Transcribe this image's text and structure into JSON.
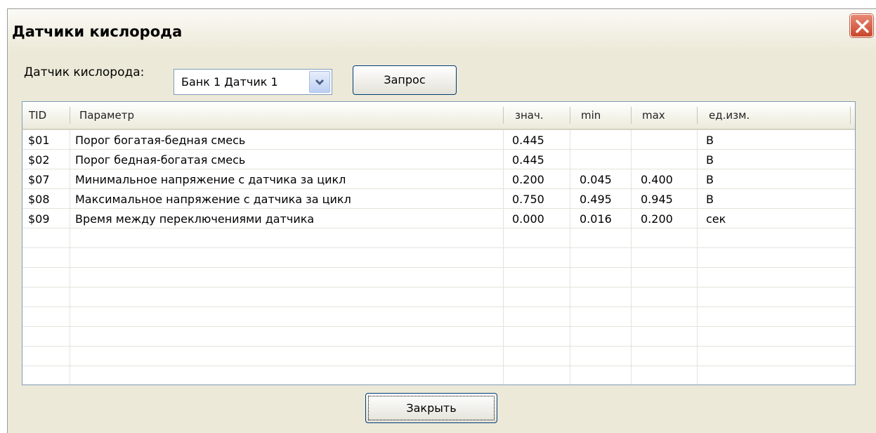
{
  "window": {
    "title": "Датчики кислорода"
  },
  "controls": {
    "sensor_label": "Датчик кислорода:",
    "sensor_selected": "Банк 1 Датчик 1",
    "query_label": "Запрос",
    "close_label": "Закрыть"
  },
  "table": {
    "columns": [
      "TID",
      "Параметр",
      "знач.",
      "min",
      "max",
      "ед.изм."
    ],
    "rows": [
      {
        "tid": "$01",
        "param": "Порог богатая-бедная смесь",
        "val": "0.445",
        "min": "",
        "max": "",
        "unit": "В"
      },
      {
        "tid": "$02",
        "param": "Порог бедная-богатая смесь",
        "val": "0.445",
        "min": "",
        "max": "",
        "unit": "В"
      },
      {
        "tid": "$07",
        "param": "Минимальное напряжение с датчика за цикл",
        "val": "0.200",
        "min": "0.045",
        "max": "0.400",
        "unit": "В"
      },
      {
        "tid": "$08",
        "param": "Максимальное напряжение с датчика за цикл",
        "val": "0.750",
        "min": "0.495",
        "max": "0.945",
        "unit": "В"
      },
      {
        "tid": "$09",
        "param": "Время между переключениями датчика",
        "val": "0.000",
        "min": "0.016",
        "max": "0.200",
        "unit": "сек"
      }
    ]
  },
  "icons": {
    "close": "close-icon",
    "dropdown": "chevron-down-icon"
  },
  "colors": {
    "close_button": "#c8462b",
    "window_bg": "#ece9d8",
    "border": "#7f9db9"
  }
}
